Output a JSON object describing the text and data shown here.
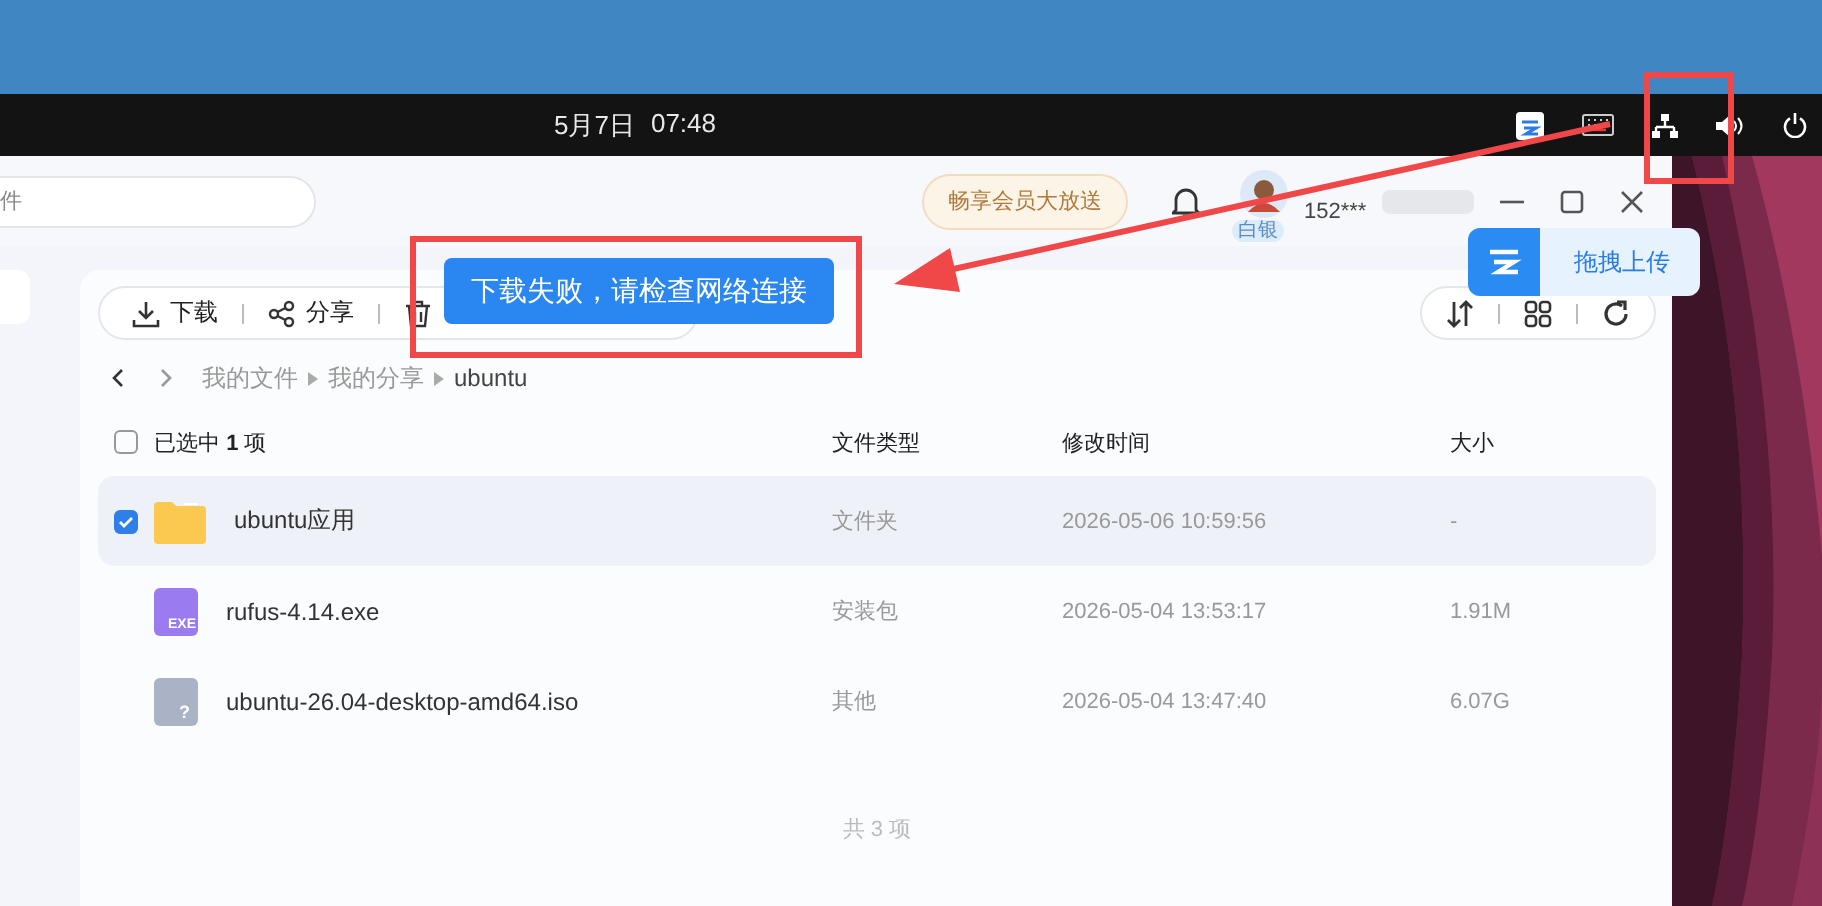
{
  "panel": {
    "date": "5月7日",
    "time": "07:48"
  },
  "app": {
    "search": {
      "placeholder": "件"
    },
    "promo": "畅享会员大放送",
    "user": {
      "name": "152***",
      "level": "白银"
    }
  },
  "toolbar": [
    {
      "kind": "download",
      "label": "下载"
    },
    {
      "kind": "share",
      "label": "分享"
    },
    {
      "kind": "delete"
    }
  ],
  "breadcrumb": [
    "我的文件",
    "我的分享",
    "ubuntu"
  ],
  "table": {
    "selection": "已选中 **1** 项",
    "all_checked": false,
    "columns": [
      "文件类型",
      "修改时间",
      "大小"
    ],
    "rows": [
      {
        "kind": "folder",
        "name": "ubuntu应用",
        "type": "文件夹",
        "modified": "2026-05-06 10:59:56",
        "size": "-",
        "selected": true
      },
      {
        "kind": "exe",
        "badge": "EXE",
        "name": "rufus-4.14.exe",
        "type": "安装包",
        "modified": "2026-05-04 13:53:17",
        "size": "1.91M",
        "selected": false
      },
      {
        "kind": "other",
        "badge": "?",
        "name": "ubuntu-26.04-desktop-amd64.iso",
        "type": "其他",
        "modified": "2026-05-04 13:47:40",
        "size": "6.07G",
        "selected": false
      }
    ]
  },
  "footer": "共 3 项",
  "toast": "下载失败，请检查网络连接",
  "upload": "拖拽上传",
  "annotations": [
    {
      "kind": "toast-box"
    },
    {
      "kind": "tray-box"
    },
    {
      "kind": "arrow"
    }
  ]
}
